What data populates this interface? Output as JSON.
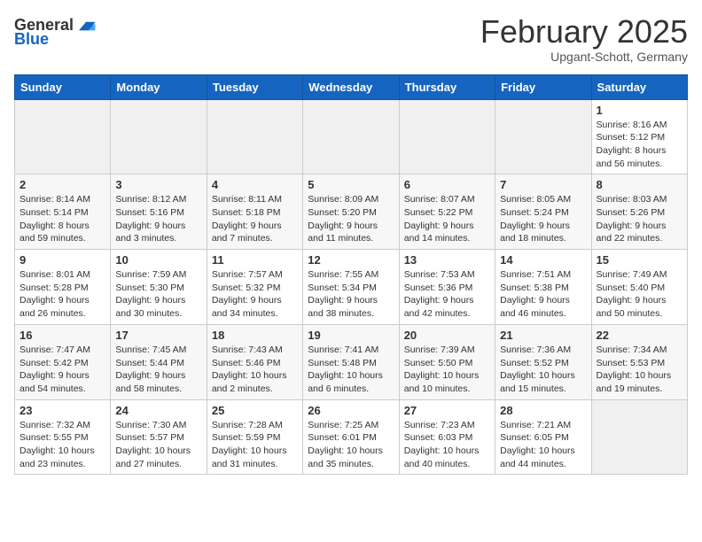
{
  "header": {
    "logo_general": "General",
    "logo_blue": "Blue",
    "month_title": "February 2025",
    "location": "Upgant-Schott, Germany"
  },
  "weekdays": [
    "Sunday",
    "Monday",
    "Tuesday",
    "Wednesday",
    "Thursday",
    "Friday",
    "Saturday"
  ],
  "weeks": [
    [
      {
        "day": "",
        "info": ""
      },
      {
        "day": "",
        "info": ""
      },
      {
        "day": "",
        "info": ""
      },
      {
        "day": "",
        "info": ""
      },
      {
        "day": "",
        "info": ""
      },
      {
        "day": "",
        "info": ""
      },
      {
        "day": "1",
        "info": "Sunrise: 8:16 AM\nSunset: 5:12 PM\nDaylight: 8 hours and 56 minutes."
      }
    ],
    [
      {
        "day": "2",
        "info": "Sunrise: 8:14 AM\nSunset: 5:14 PM\nDaylight: 8 hours and 59 minutes."
      },
      {
        "day": "3",
        "info": "Sunrise: 8:12 AM\nSunset: 5:16 PM\nDaylight: 9 hours and 3 minutes."
      },
      {
        "day": "4",
        "info": "Sunrise: 8:11 AM\nSunset: 5:18 PM\nDaylight: 9 hours and 7 minutes."
      },
      {
        "day": "5",
        "info": "Sunrise: 8:09 AM\nSunset: 5:20 PM\nDaylight: 9 hours and 11 minutes."
      },
      {
        "day": "6",
        "info": "Sunrise: 8:07 AM\nSunset: 5:22 PM\nDaylight: 9 hours and 14 minutes."
      },
      {
        "day": "7",
        "info": "Sunrise: 8:05 AM\nSunset: 5:24 PM\nDaylight: 9 hours and 18 minutes."
      },
      {
        "day": "8",
        "info": "Sunrise: 8:03 AM\nSunset: 5:26 PM\nDaylight: 9 hours and 22 minutes."
      }
    ],
    [
      {
        "day": "9",
        "info": "Sunrise: 8:01 AM\nSunset: 5:28 PM\nDaylight: 9 hours and 26 minutes."
      },
      {
        "day": "10",
        "info": "Sunrise: 7:59 AM\nSunset: 5:30 PM\nDaylight: 9 hours and 30 minutes."
      },
      {
        "day": "11",
        "info": "Sunrise: 7:57 AM\nSunset: 5:32 PM\nDaylight: 9 hours and 34 minutes."
      },
      {
        "day": "12",
        "info": "Sunrise: 7:55 AM\nSunset: 5:34 PM\nDaylight: 9 hours and 38 minutes."
      },
      {
        "day": "13",
        "info": "Sunrise: 7:53 AM\nSunset: 5:36 PM\nDaylight: 9 hours and 42 minutes."
      },
      {
        "day": "14",
        "info": "Sunrise: 7:51 AM\nSunset: 5:38 PM\nDaylight: 9 hours and 46 minutes."
      },
      {
        "day": "15",
        "info": "Sunrise: 7:49 AM\nSunset: 5:40 PM\nDaylight: 9 hours and 50 minutes."
      }
    ],
    [
      {
        "day": "16",
        "info": "Sunrise: 7:47 AM\nSunset: 5:42 PM\nDaylight: 9 hours and 54 minutes."
      },
      {
        "day": "17",
        "info": "Sunrise: 7:45 AM\nSunset: 5:44 PM\nDaylight: 9 hours and 58 minutes."
      },
      {
        "day": "18",
        "info": "Sunrise: 7:43 AM\nSunset: 5:46 PM\nDaylight: 10 hours and 2 minutes."
      },
      {
        "day": "19",
        "info": "Sunrise: 7:41 AM\nSunset: 5:48 PM\nDaylight: 10 hours and 6 minutes."
      },
      {
        "day": "20",
        "info": "Sunrise: 7:39 AM\nSunset: 5:50 PM\nDaylight: 10 hours and 10 minutes."
      },
      {
        "day": "21",
        "info": "Sunrise: 7:36 AM\nSunset: 5:52 PM\nDaylight: 10 hours and 15 minutes."
      },
      {
        "day": "22",
        "info": "Sunrise: 7:34 AM\nSunset: 5:53 PM\nDaylight: 10 hours and 19 minutes."
      }
    ],
    [
      {
        "day": "23",
        "info": "Sunrise: 7:32 AM\nSunset: 5:55 PM\nDaylight: 10 hours and 23 minutes."
      },
      {
        "day": "24",
        "info": "Sunrise: 7:30 AM\nSunset: 5:57 PM\nDaylight: 10 hours and 27 minutes."
      },
      {
        "day": "25",
        "info": "Sunrise: 7:28 AM\nSunset: 5:59 PM\nDaylight: 10 hours and 31 minutes."
      },
      {
        "day": "26",
        "info": "Sunrise: 7:25 AM\nSunset: 6:01 PM\nDaylight: 10 hours and 35 minutes."
      },
      {
        "day": "27",
        "info": "Sunrise: 7:23 AM\nSunset: 6:03 PM\nDaylight: 10 hours and 40 minutes."
      },
      {
        "day": "28",
        "info": "Sunrise: 7:21 AM\nSunset: 6:05 PM\nDaylight: 10 hours and 44 minutes."
      },
      {
        "day": "",
        "info": ""
      }
    ]
  ]
}
